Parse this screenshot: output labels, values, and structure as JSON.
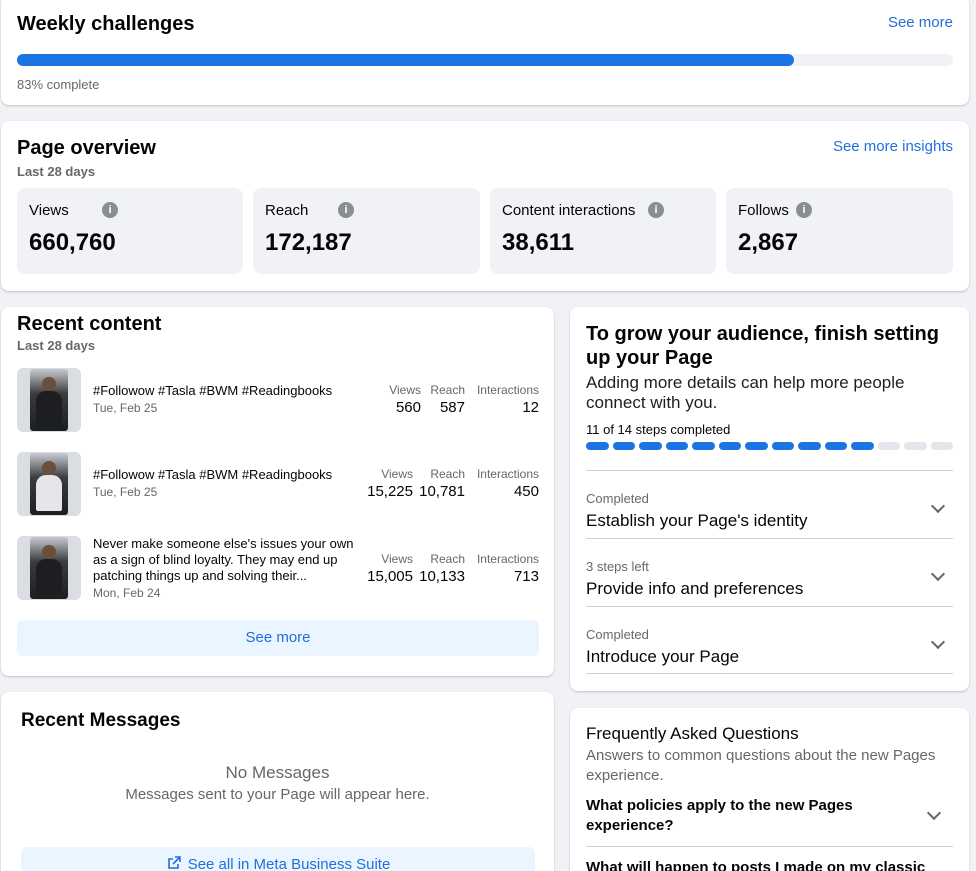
{
  "weekly": {
    "title": "Weekly challenges",
    "see_more": "See more",
    "progress_percent": 83,
    "progress_text": "83% complete",
    "accent": "#1b74e4"
  },
  "overview": {
    "title": "Page overview",
    "period": "Last 28 days",
    "see_more": "See more insights",
    "stats": [
      {
        "label": "Views",
        "value": "660,760"
      },
      {
        "label": "Reach",
        "value": "172,187"
      },
      {
        "label": "Content interactions",
        "value": "38,611"
      },
      {
        "label": "Follows",
        "value": "2,867"
      }
    ],
    "info_icon": "i"
  },
  "recent": {
    "title": "Recent content",
    "period": "Last 28 days",
    "metric_labels": {
      "views": "Views",
      "reach": "Reach",
      "interactions": "Interactions"
    },
    "posts": [
      {
        "text": "#Followow #Tasla #BWM #Readingbooks",
        "date": "Tue, Feb 25",
        "views": "560",
        "reach": "587",
        "interactions": "12"
      },
      {
        "text": "#Followow #Tasla #BWM #Readingbooks",
        "date": "Tue, Feb 25",
        "views": "15,225",
        "reach": "10,781",
        "interactions": "450"
      },
      {
        "text": "Never make someone else's issues your own as a sign of blind loyalty. They may end up patching things up and solving their...",
        "date": "Mon, Feb 24",
        "views": "15,005",
        "reach": "10,133",
        "interactions": "713"
      }
    ],
    "see_more": "See more"
  },
  "messages": {
    "title": "Recent Messages",
    "empty_title": "No Messages",
    "empty_sub": "Messages sent to your Page will appear here.",
    "button": "See all in Meta Business Suite"
  },
  "grow": {
    "title": "To grow your audience, finish setting up your Page",
    "desc": "Adding more details can help more people connect with you.",
    "steps_label": "11 of 14 steps completed",
    "steps_done": 11,
    "steps_total": 14,
    "items": [
      {
        "status": "Completed",
        "title": "Establish your Page's identity"
      },
      {
        "status": "3 steps left",
        "title": "Provide info and preferences"
      },
      {
        "status": "Completed",
        "title": "Introduce your Page"
      }
    ]
  },
  "faq": {
    "title": "Frequently Asked Questions",
    "sub": "Answers to common questions about the new Pages experience.",
    "questions": [
      "What policies apply to the new Pages experience?",
      "What will happen to posts I made on my classic"
    ]
  }
}
